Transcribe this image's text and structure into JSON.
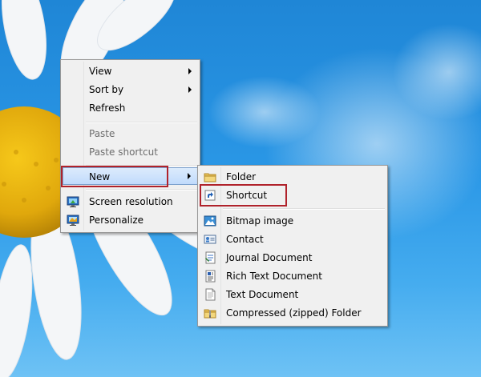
{
  "context_menu": {
    "items": [
      {
        "label": "View",
        "submenu": true
      },
      {
        "label": "Sort by",
        "submenu": true
      },
      {
        "label": "Refresh"
      },
      {
        "label": "Paste",
        "disabled": true
      },
      {
        "label": "Paste shortcut",
        "disabled": true
      },
      {
        "label": "New",
        "submenu": true,
        "highlighted": true
      },
      {
        "label": "Screen resolution",
        "icon": "monitor-icon"
      },
      {
        "label": "Personalize",
        "icon": "personalize-icon"
      }
    ]
  },
  "new_submenu": {
    "items": [
      {
        "label": "Folder",
        "icon": "folder-icon"
      },
      {
        "label": "Shortcut",
        "icon": "shortcut-icon",
        "highlighted": true
      },
      {
        "label": "Bitmap image",
        "icon": "bitmap-image-icon"
      },
      {
        "label": "Contact",
        "icon": "contact-card-icon"
      },
      {
        "label": "Journal Document",
        "icon": "journal-document-icon"
      },
      {
        "label": "Rich Text Document",
        "icon": "rich-text-document-icon"
      },
      {
        "label": "Text Document",
        "icon": "text-document-icon"
      },
      {
        "label": "Compressed (zipped) Folder",
        "icon": "zipped-folder-icon"
      }
    ]
  },
  "colors": {
    "highlight_border": "#b0222b",
    "menu_background": "#f0f0f0",
    "desktop_blue": "#2a97e6"
  }
}
